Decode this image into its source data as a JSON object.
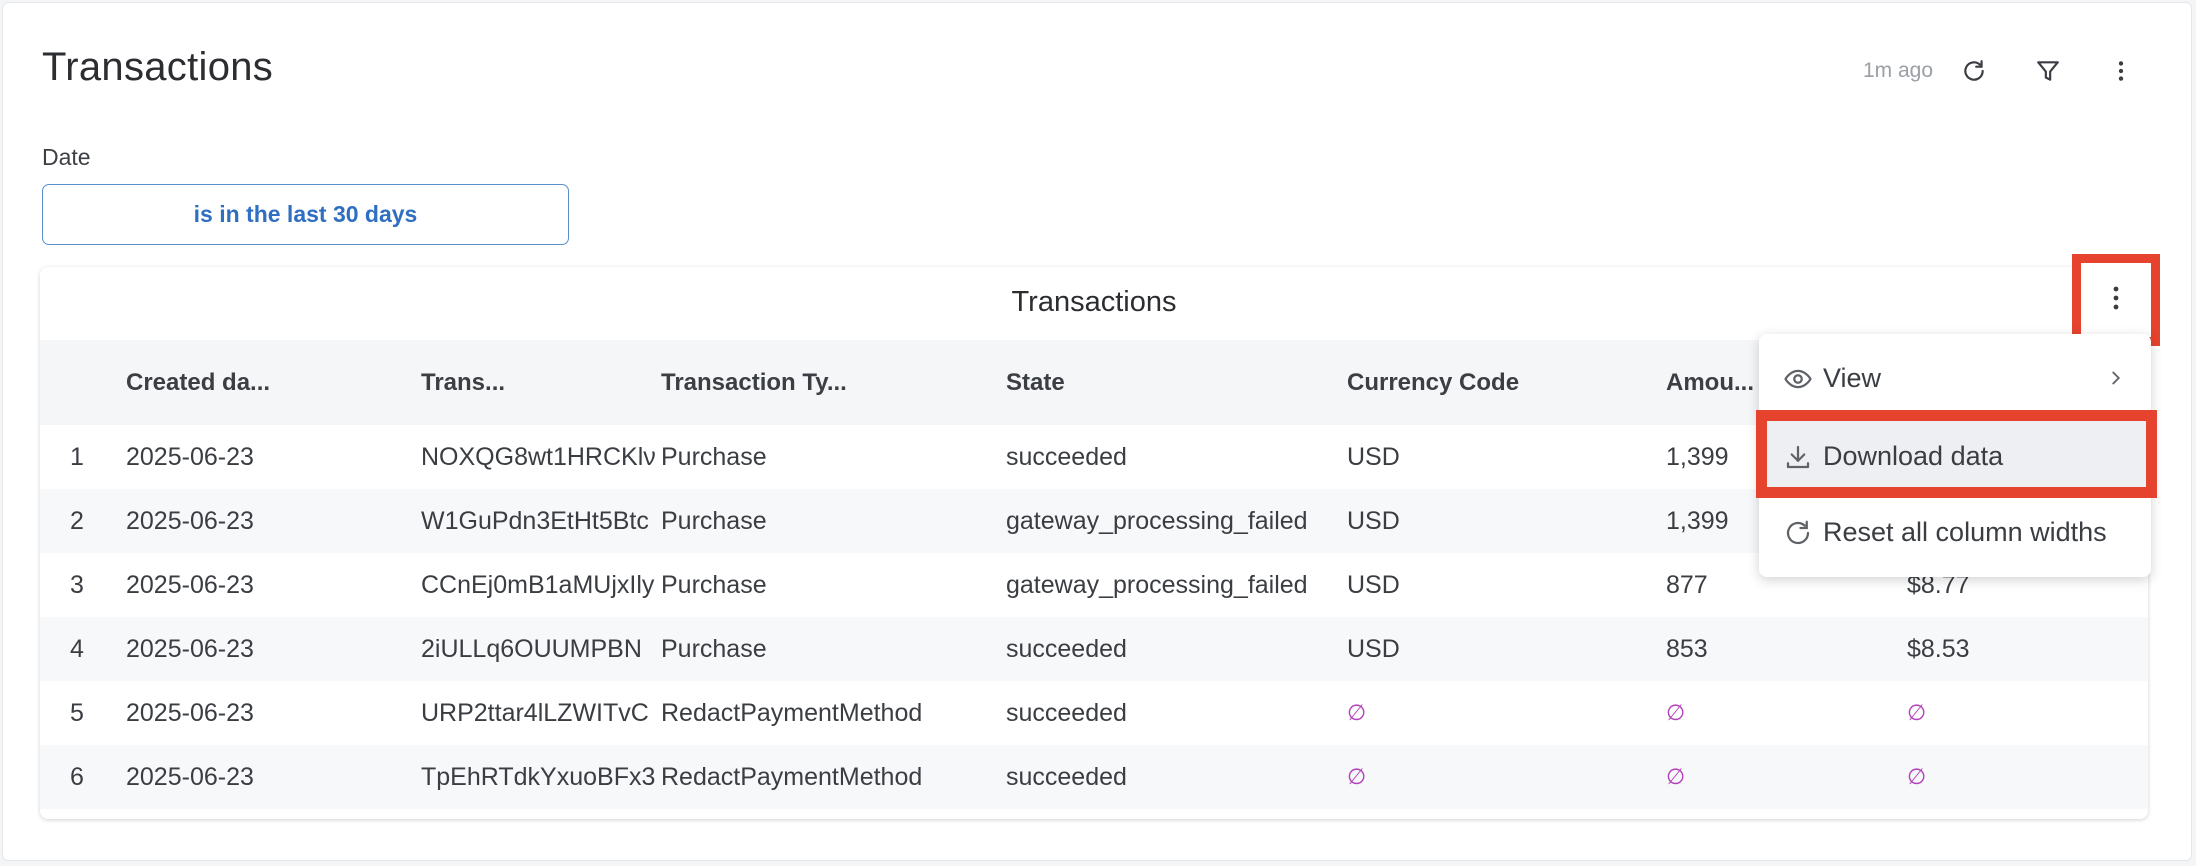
{
  "header": {
    "title": "Transactions",
    "updated": "1m ago"
  },
  "filter": {
    "label": "Date",
    "value": "is in the last 30 days"
  },
  "table": {
    "title": "Transactions",
    "columns": [
      "Created da...",
      "Trans...",
      "Transaction Ty...",
      "State",
      "Currency Code",
      "Amou..."
    ],
    "rows": [
      {
        "num": "1",
        "created": "2025-06-23",
        "trans": "NOXQG8wt1HRCKlν",
        "type": "Purchase",
        "state": "succeeded",
        "currency": "USD",
        "amount": "1,399",
        "formatted": ""
      },
      {
        "num": "2",
        "created": "2025-06-23",
        "trans": "W1GuPdn3EtHt5Btc",
        "type": "Purchase",
        "state": "gateway_processing_failed",
        "currency": "USD",
        "amount": "1,399",
        "formatted": ""
      },
      {
        "num": "3",
        "created": "2025-06-23",
        "trans": "CCnEj0mB1aMUjxIly",
        "type": "Purchase",
        "state": "gateway_processing_failed",
        "currency": "USD",
        "amount": "877",
        "formatted": "$8.77"
      },
      {
        "num": "4",
        "created": "2025-06-23",
        "trans": "2iULLq6OUUMPBN",
        "type": "Purchase",
        "state": "succeeded",
        "currency": "USD",
        "amount": "853",
        "formatted": "$8.53"
      },
      {
        "num": "5",
        "created": "2025-06-23",
        "trans": "URP2ttar4lLZWITvC",
        "type": "RedactPaymentMethod",
        "state": "succeeded",
        "currency": "∅",
        "amount": "∅",
        "formatted": "∅"
      },
      {
        "num": "6",
        "created": "2025-06-23",
        "trans": "TpEhRTdkYxuoBFx3",
        "type": "RedactPaymentMethod",
        "state": "succeeded",
        "currency": "∅",
        "amount": "∅",
        "formatted": "∅"
      }
    ]
  },
  "menu": {
    "items": [
      {
        "label": "View",
        "icon": "eye-icon"
      },
      {
        "label": "Download data",
        "icon": "download-icon"
      },
      {
        "label": "Reset all column widths",
        "icon": "reset-icon"
      }
    ]
  },
  "colors": {
    "highlight": "#e5432d",
    "null_marker": "#b23fb8",
    "filter_accent": "#2f6fc2"
  }
}
